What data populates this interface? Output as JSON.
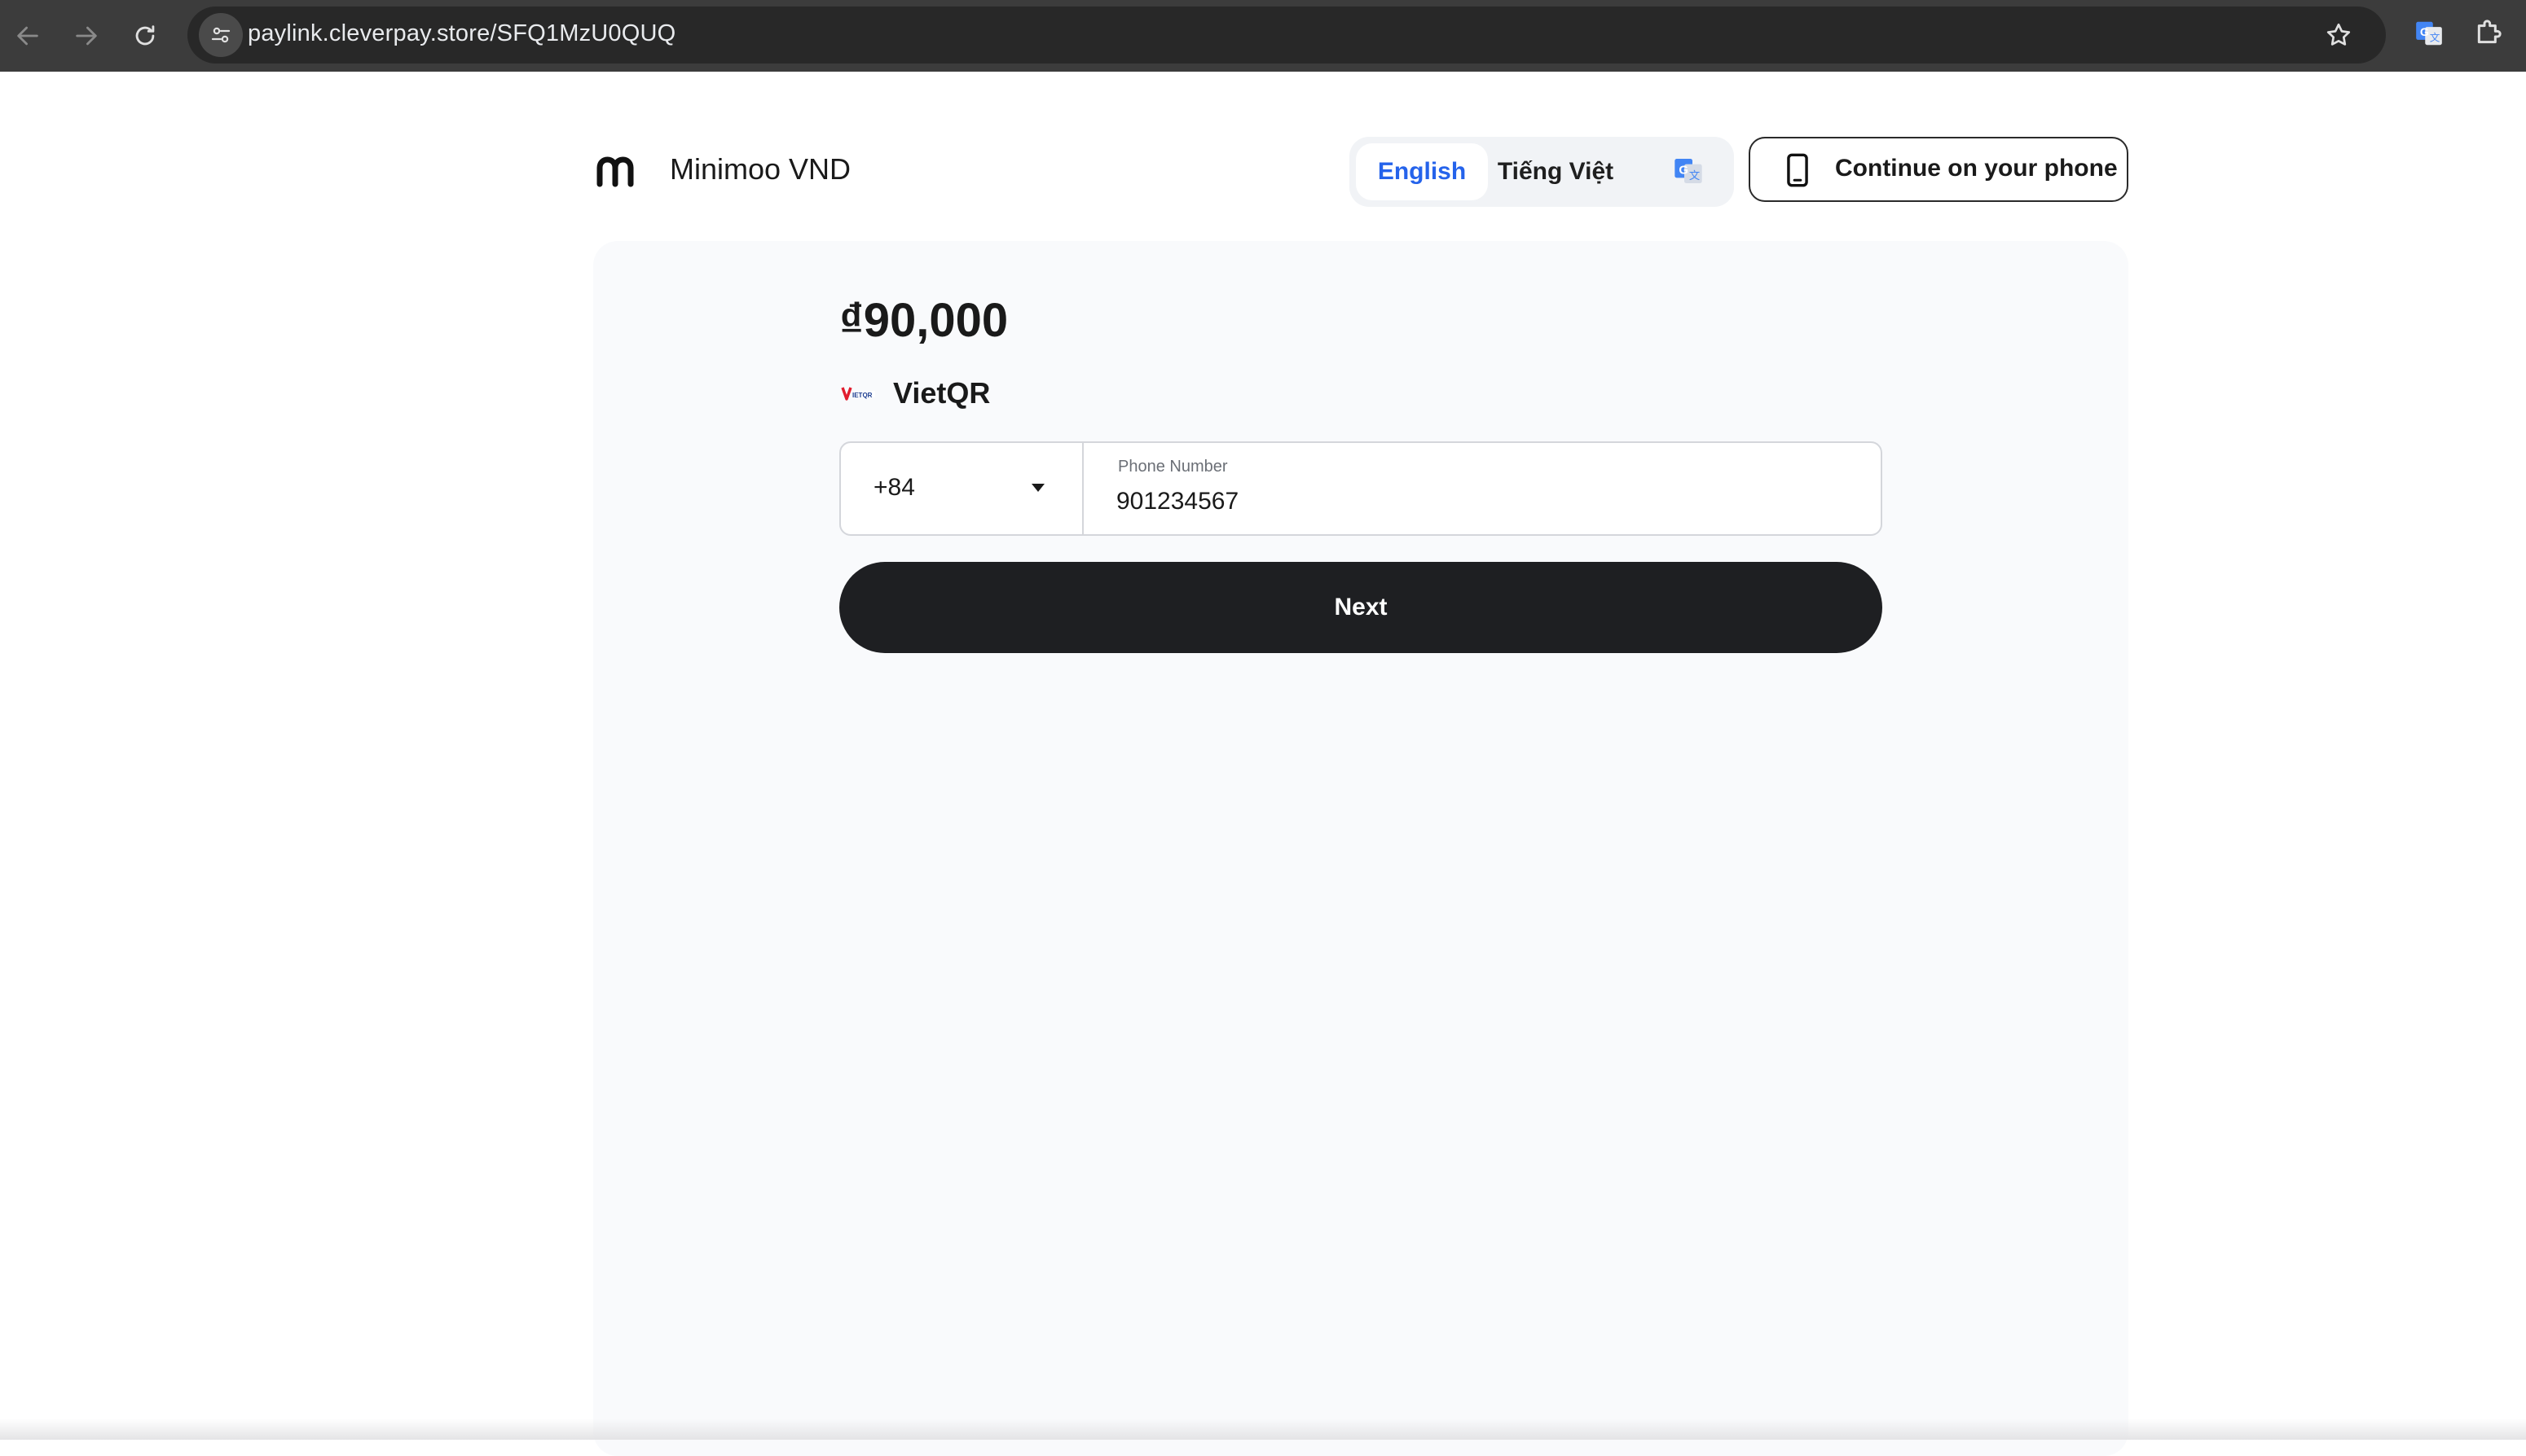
{
  "browser": {
    "url": "paylink.cleverpay.store/SFQ1MzU0QUQ",
    "icons": {
      "back": "arrow-left-icon",
      "forward": "arrow-right-icon",
      "reload": "reload-icon",
      "site_info": "tune-icon",
      "bookmark": "star-icon",
      "translate_extension": "google-translate-icon",
      "extensions": "puzzle-icon"
    }
  },
  "header": {
    "brand_name": "Minimoo VND",
    "language_options": [
      {
        "label": "English",
        "selected": true
      },
      {
        "label": "Tiếng Việt",
        "selected": false
      }
    ],
    "continue_phone_label": "Continue on your phone"
  },
  "payment": {
    "amount": "₫90,000",
    "method": "VietQR",
    "country_code": "+84",
    "phone_label": "Phone Number",
    "phone_value": "901234567",
    "next_label": "Next"
  },
  "colors": {
    "accent": "#2563eb",
    "button_dark": "#1e1f22",
    "card_bg": "#f9fafc",
    "chrome_bg": "#3c3c3c",
    "vietqr_red": "#e11d2e"
  }
}
